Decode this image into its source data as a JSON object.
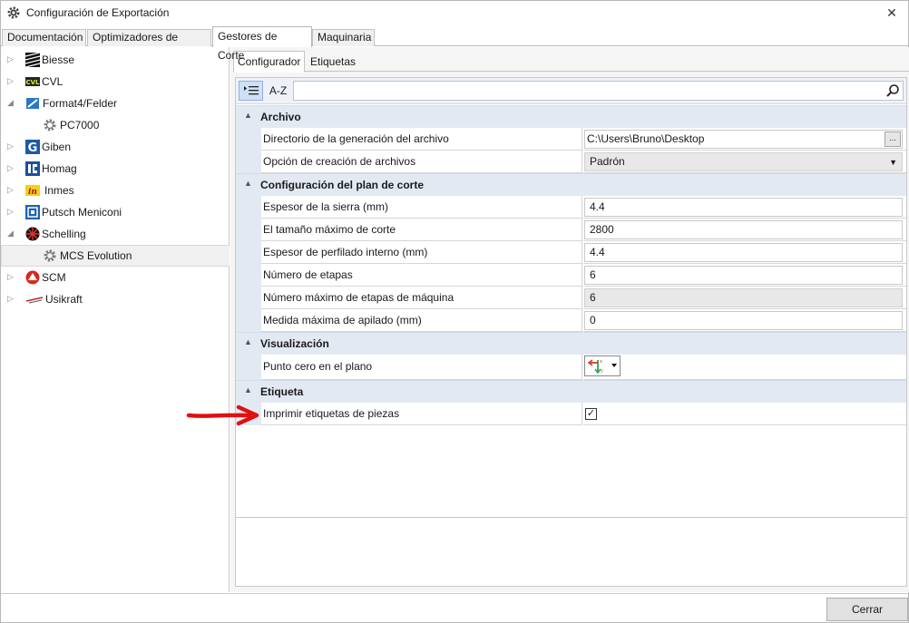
{
  "window": {
    "title": "Configuración de Exportación"
  },
  "tabs": [
    {
      "label": "Documentación"
    },
    {
      "label": "Optimizadores de Corte"
    },
    {
      "label": "Gestores de Corte",
      "active": true
    },
    {
      "label": "Maquinaria"
    }
  ],
  "tree": [
    {
      "label": "Biesse",
      "icon": "biesse-logo-icon"
    },
    {
      "label": "CVL",
      "icon": "cvl-logo-icon"
    },
    {
      "label": "Format4/Felder",
      "icon": "format4-logo-icon",
      "expanded": true
    },
    {
      "label": "PC7000",
      "icon": "gear-icon",
      "child": true
    },
    {
      "label": "Giben",
      "icon": "giben-logo-icon"
    },
    {
      "label": "Homag",
      "icon": "homag-logo-icon"
    },
    {
      "label": "Inmes",
      "icon": "inmes-logo-icon"
    },
    {
      "label": "Putsch Meniconi",
      "icon": "putsch-logo-icon"
    },
    {
      "label": "Schelling",
      "icon": "schelling-logo-icon",
      "expanded": true
    },
    {
      "label": "MCS Evolution",
      "icon": "gear-icon",
      "child": true,
      "selected": true
    },
    {
      "label": "SCM",
      "icon": "scm-logo-icon"
    },
    {
      "label": "Usikraft",
      "icon": "usikraft-logo-icon"
    }
  ],
  "subtabs": [
    {
      "label": "Configurador",
      "active": true
    },
    {
      "label": "Etiquetas"
    }
  ],
  "toolbar": {
    "sort_alpha_label": "A-Z"
  },
  "grid": {
    "archivo": {
      "label": "Archivo",
      "dir_label": "Directorio de la generación del archivo",
      "dir_value": "C:\\Users\\Bruno\\Desktop",
      "browse_label": "...",
      "creation_label": "Opción de creación de archivos",
      "creation_value": "Padrón"
    },
    "plan": {
      "label": "Configuración del plan de corte",
      "saw_label": "Espesor de la sierra (mm)",
      "saw_value": "4.4",
      "maxcut_label": "El tamaño máximo de corte",
      "maxcut_value": "2800",
      "profile_label": "Espesor de perfilado interno (mm)",
      "profile_value": "4.4",
      "stages_label": "Número de etapas",
      "stages_value": "6",
      "maxstages_label": "Número máximo de etapas de máquina",
      "maxstages_value": "6",
      "stack_label": "Medida máxima de apilado (mm)",
      "stack_value": "0"
    },
    "visual": {
      "label": "Visualización",
      "zero_label": "Punto cero en el plano"
    },
    "etiqueta": {
      "label": "Etiqueta",
      "print_label": "Imprimir etiquetas de piezas",
      "print_checked": "✓"
    }
  },
  "footer": {
    "close_label": "Cerrar"
  },
  "colors": {
    "annotation_arrow": "#e01010",
    "category_bg": "#e3e9f3"
  }
}
